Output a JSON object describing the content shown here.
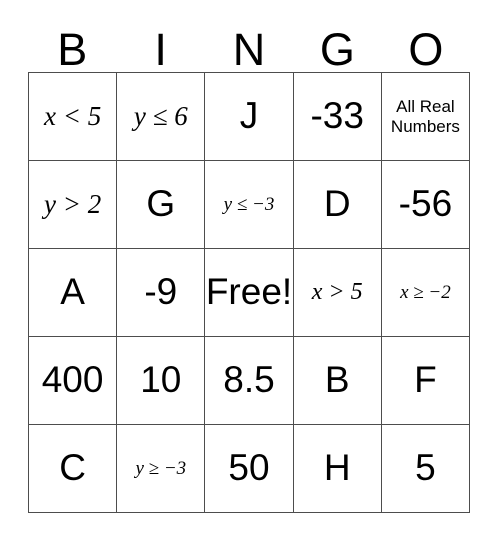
{
  "card": {
    "title": "BINGO",
    "headers": [
      "B",
      "I",
      "N",
      "G",
      "O"
    ],
    "free_space_label": "Free!",
    "colors": {
      "border": "#4d4d4d",
      "background": "#ffffff",
      "text": "#000000"
    },
    "rows": [
      [
        {
          "text": "x < 5",
          "style": "math"
        },
        {
          "text": "y ≤ 6",
          "style": "math"
        },
        {
          "text": "J",
          "style": "plain"
        },
        {
          "text": "-33",
          "style": "plain"
        },
        {
          "text": "All Real Numbers",
          "style": "small"
        }
      ],
      [
        {
          "text": "y > 2",
          "style": "math"
        },
        {
          "text": "G",
          "style": "plain"
        },
        {
          "text": "y ≤ −3",
          "style": "math-sm"
        },
        {
          "text": "D",
          "style": "plain"
        },
        {
          "text": "-56",
          "style": "plain"
        }
      ],
      [
        {
          "text": "A",
          "style": "plain"
        },
        {
          "text": "-9",
          "style": "plain"
        },
        {
          "text": "Free!",
          "style": "plain"
        },
        {
          "text": "x > 5",
          "style": "math-md"
        },
        {
          "text": "x ≥ −2",
          "style": "math-sm"
        }
      ],
      [
        {
          "text": "400",
          "style": "plain"
        },
        {
          "text": "10",
          "style": "plain"
        },
        {
          "text": "8.5",
          "style": "plain"
        },
        {
          "text": "B",
          "style": "plain"
        },
        {
          "text": "F",
          "style": "plain"
        }
      ],
      [
        {
          "text": "C",
          "style": "plain"
        },
        {
          "text": "y ≥ −3",
          "style": "math-sm"
        },
        {
          "text": "50",
          "style": "plain"
        },
        {
          "text": "H",
          "style": "plain"
        },
        {
          "text": "5",
          "style": "plain"
        }
      ]
    ]
  }
}
